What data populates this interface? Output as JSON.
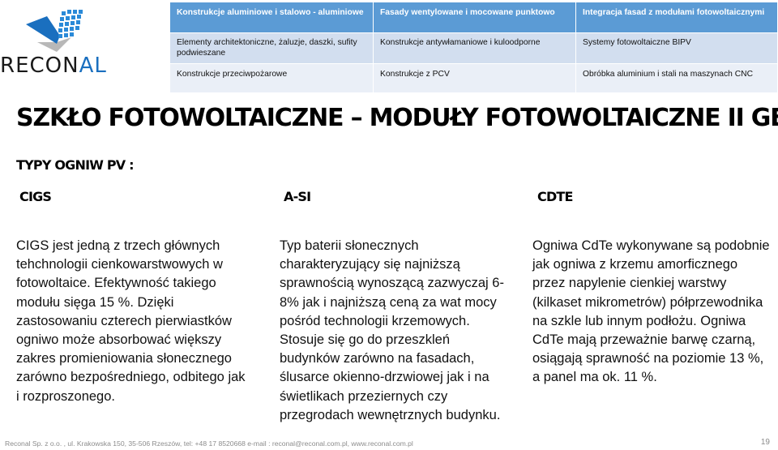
{
  "logo": {
    "text_main": "RECON",
    "text_accent": "AL",
    "brand_color": "#1a6fbf"
  },
  "nav_table": {
    "header": [
      "Konstrukcje aluminiowe i stalowo - aluminiowe",
      "Fasady wentylowane i mocowane punktowo",
      "Integracja fasad z modułami fotowoltaicznymi"
    ],
    "rows": [
      [
        "Elementy architektoniczne, żaluzje, daszki, sufity podwieszane",
        "Konstrukcje antywłamaniowe i kuloodporne",
        "Systemy fotowoltaiczne BIPV"
      ],
      [
        "Konstrukcje przeciwpożarowe",
        "Konstrukcje z PCV",
        "Obróbka aluminium i stali na maszynach CNC"
      ]
    ],
    "colors": {
      "header": "#5b9bd5",
      "row1": "#d2deef",
      "row2": "#eaeff7"
    }
  },
  "slide": {
    "title": "SZKŁO FOTOWOLTAICZNE – MODUŁY FOTOWOLTAICZNE II GENERACJI",
    "subtitle": "TYPY OGNIW PV :",
    "columns": [
      {
        "heading": "CIGS",
        "body": "CIGS jest jedną z trzech głównych tehchnologii cienkowarstwowych w fotowoltaice. Efektywność takiego modułu sięga 15 %. Dzięki zastosowaniu czterech pierwiastków ogniwo może absorbować większy zakres promieniowania słonecznego zarówno bezpośredniego, odbitego jak i rozproszonego."
      },
      {
        "heading": "A-SI",
        "body": "Typ baterii słonecznych charakteryzujący się najniższą sprawnością wynoszącą zazwyczaj 6-8% jak i najniższą ceną za wat mocy pośród technologii krzemowych. Stosuje się go do przeszkleń budynków zarówno na fasadach, ślusarce okienno-drzwiowej jak i na świetlikach przeziernych czy przegrodach wewnętrznych budynku."
      },
      {
        "heading": "CDTE",
        "body": "Ogniwa CdTe wykonywane są podobnie jak ogniwa z krzemu amorficznego przez napylenie cienkiej warstwy  (kilkaset mikrometrów) półprzewodnika na szkle lub innym podłożu. Ogniwa CdTe mają przeważnie barwę czarną, osiągają sprawność na poziomie 13 %, a panel ma ok. 11 %."
      }
    ]
  },
  "footer": {
    "text": "Reconal Sp. z o.o. , ul. Krakowska 150, 35-506 Rzeszów, tel: +48 17 8520668  e-mail : reconal@reconal.com.pl,  www.reconal.com.pl",
    "page_number": "19"
  }
}
